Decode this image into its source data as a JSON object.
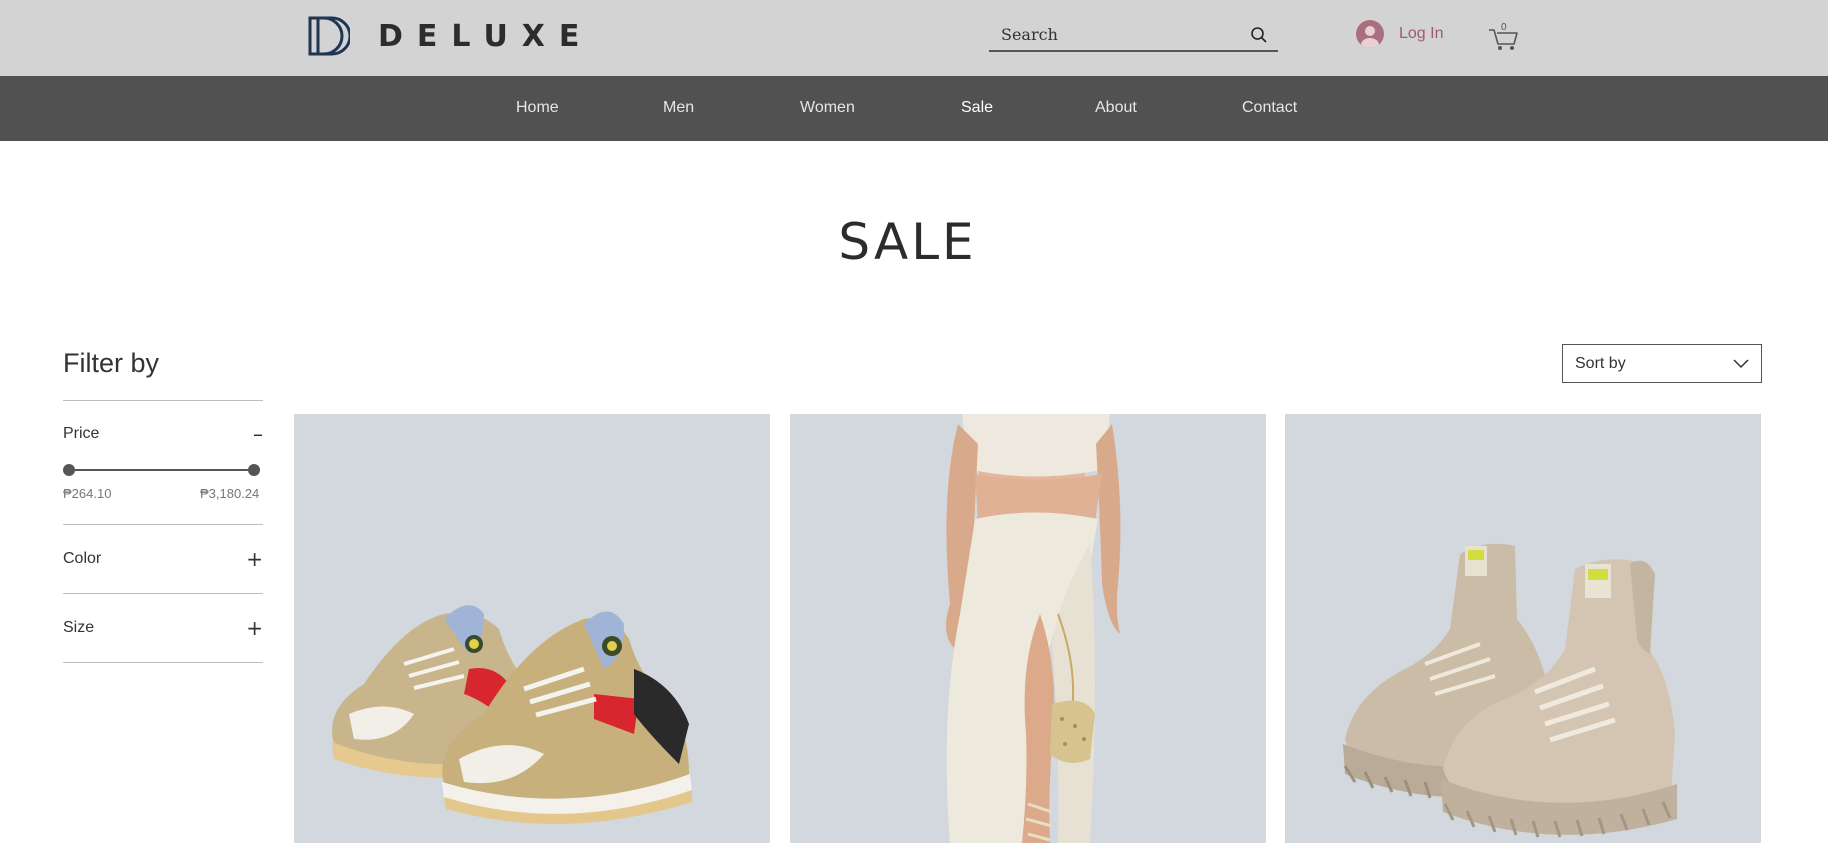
{
  "header": {
    "brand": "DELUXE",
    "search": {
      "placeholder": "Search"
    },
    "login_label": "Log In",
    "cart_count": "0"
  },
  "nav": {
    "items": [
      {
        "label": "Home"
      },
      {
        "label": "Men"
      },
      {
        "label": "Women"
      },
      {
        "label": "Sale"
      },
      {
        "label": "About"
      },
      {
        "label": "Contact"
      }
    ],
    "active": "Sale"
  },
  "page": {
    "title": "SALE"
  },
  "filters": {
    "title": "Filter by",
    "price": {
      "label": "Price",
      "toggle": "–",
      "min_label": "₱264.10",
      "max_label": "₱3,180.24"
    },
    "color": {
      "label": "Color",
      "toggle": "+"
    },
    "size": {
      "label": "Size",
      "toggle": "+"
    }
  },
  "sort": {
    "label": "Sort by"
  },
  "products": [
    {
      "image": "sneakers"
    },
    {
      "image": "skirt-outfit"
    },
    {
      "image": "chunky-boots"
    }
  ],
  "colors": {
    "header_bg": "#d3d3d3",
    "nav_bg": "#515151",
    "product_bg": "#d2d8de",
    "logo_blue": "#1f3552",
    "login_accent": "#a05a6c"
  }
}
